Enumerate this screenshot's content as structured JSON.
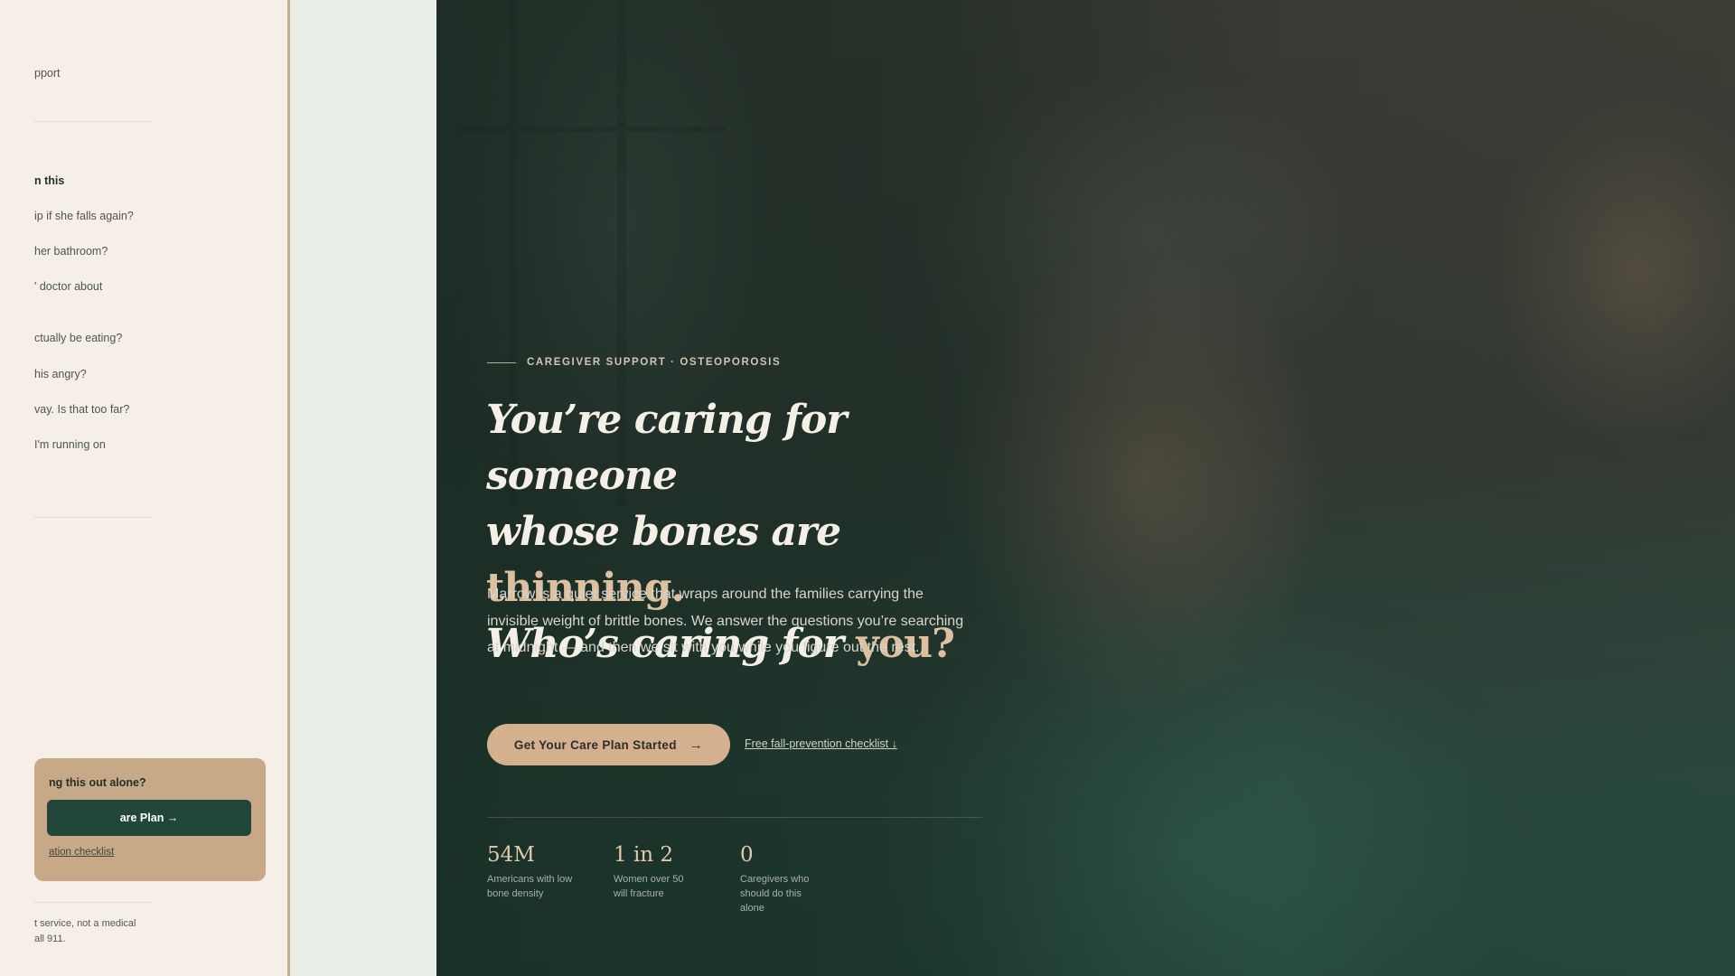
{
  "side_panel": {
    "support_link": "pport",
    "section_heading": "n this",
    "questions": [
      "ip if she falls again?",
      "her bathroom?",
      "' doctor about",
      "ctually be eating?",
      "his angry?",
      "vay. Is that too far?",
      " I'm running on"
    ],
    "card": {
      "title": "ng this out alone?",
      "button_label": "are Plan →",
      "link_label": "ation checklist"
    },
    "footer_line1": "t service, not a medical",
    "footer_line2": "all 911."
  },
  "hero": {
    "eyebrow": "CAREGIVER SUPPORT · OSTEOPOROSIS",
    "headline": {
      "line1": "You’re caring for someone",
      "line2_a": "whose bones are ",
      "line2_accent": "thinning.",
      "line3_a": "Who’s caring for ",
      "line3_accent": "you?"
    },
    "lede": "Marrow is a quiet service that wraps around the families carrying the invisible weight of brittle bones. We answer the questions you’re searching at midnight — and then we sit with you while you figure out the rest.",
    "cta_label": "Get Your Care Plan Started",
    "cta_icon": "arrow-right-icon",
    "secondary_link": "Free fall-prevention checklist ↓",
    "stats": [
      {
        "value": "54M",
        "label": "Americans with low bone density"
      },
      {
        "value": "1 in 2",
        "label": "Women over 50 will fracture"
      },
      {
        "value": "0",
        "label": "Caregivers who should do this alone"
      }
    ]
  },
  "colors": {
    "panel_bg": "#f6efe8",
    "hero_green": "#26493c",
    "accent_tan": "#d4b08f",
    "headline_accent": "#dcc0a0"
  }
}
